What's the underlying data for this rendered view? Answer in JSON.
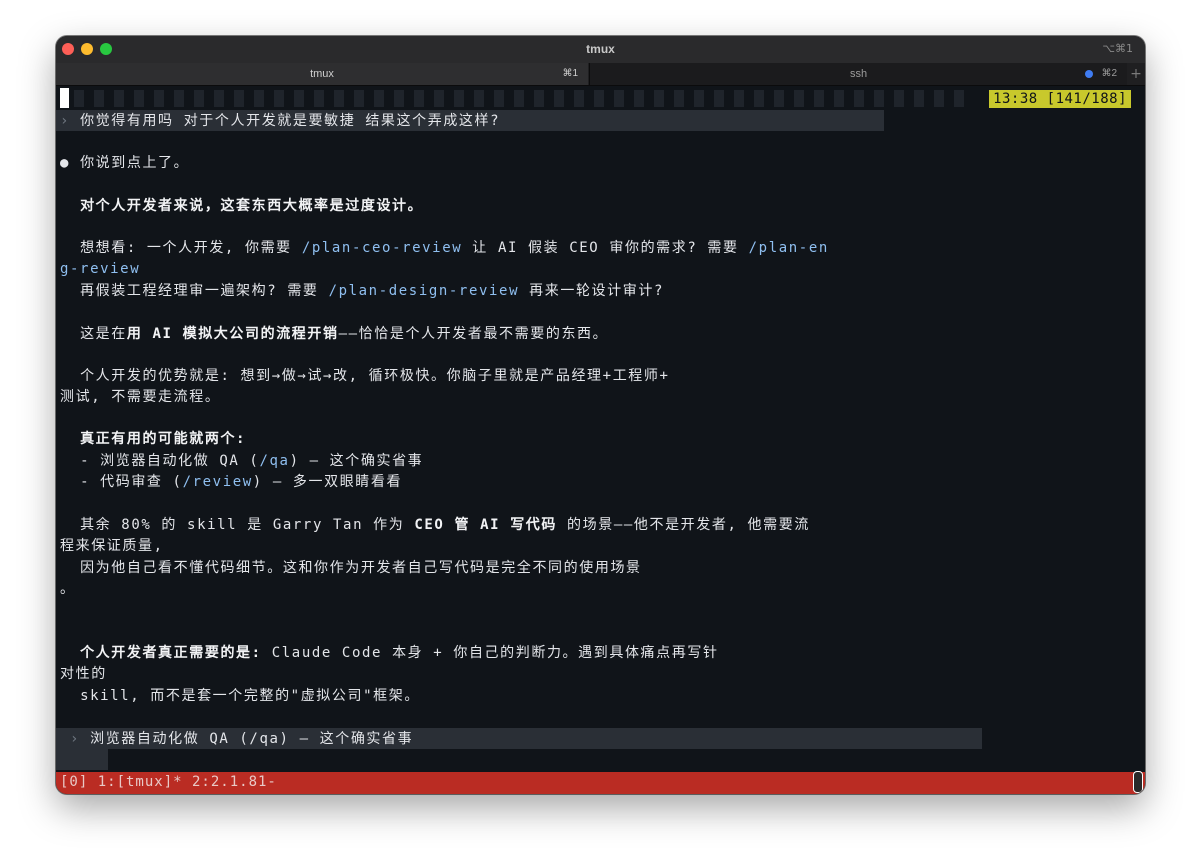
{
  "window": {
    "title": "tmux",
    "shortcut": "⌥⌘1"
  },
  "tabs": [
    {
      "label": "tmux",
      "key": "⌘1"
    },
    {
      "label": "ssh",
      "key": "⌘2"
    }
  ],
  "new_tab_label": "+",
  "terminal": {
    "clock": "13:38 [141/188]",
    "prompt_arrow": "›",
    "user_question": "你觉得有用吗 对于个人开发就是要敏捷 结果这个弄成这样?",
    "bullet": "●",
    "l_reply": "你说到点上了。",
    "l_bold1": "对个人开发者来说，这套东西大概率是过度设计。",
    "l_a_pre": "想想看: 一个人开发, 你需要 ",
    "cmd_ceo": "/plan-ceo-review",
    "l_a_mid": " 让 AI 假装 CEO 审你的需求? 需要 ",
    "cmd_eng_1": "/plan-en",
    "cmd_eng_2": "g-review",
    "l_b_pre": "再假装工程经理审一遍架构? 需要 ",
    "cmd_design": "/plan-design-review",
    "l_b_post": " 再来一轮设计审计?",
    "l_c_pre": "这是在",
    "l_c_bold": "用 AI 模拟大公司的流程开销",
    "l_c_post": "——恰恰是个人开发者最不需要的东西。",
    "l_d_1": "个人开发的优势就是: 想到→做→试→改, 循环极快。你脑子里就是产品经理+工程师+",
    "l_d_2": "测试, 不需要走流程。",
    "l_e_bold": "真正有用的可能就两个:",
    "l_e_1_pre": "- 浏览器自动化做 QA (",
    "cmd_qa": "/qa",
    "l_e_1_post": ") — 这个确实省事",
    "l_e_2_pre": "- 代码审查 (",
    "cmd_review": "/review",
    "l_e_2_post": ") — 多一双眼睛看看",
    "l_f_pre": "其余 80% 的 skill 是 Garry Tan 作为 ",
    "l_f_bold": "CEO 管 AI 写代码",
    "l_f_post": " 的场景——他不是开发者, 他需要流",
    "l_f_2": "程来保证质量,",
    "l_f_3": "因为他自己看不懂代码细节。这和你作为开发者自己写代码是完全不同的使用场景",
    "l_f_4": "。",
    "l_g_bold": "个人开发者真正需要的是:",
    "l_g_post": " Claude Code 本身 + 你自己的判断力。遇到具体痛点再写针",
    "l_g_2": "对性的",
    "l_g_3": "skill, 而不是套一个完整的\"虚拟公司\"框架。",
    "input_line": "浏览器自动化做 QA (/qa) — 这个确实省事"
  },
  "status_bar": "[0] 1:[tmux]* 2:2.1.81-"
}
